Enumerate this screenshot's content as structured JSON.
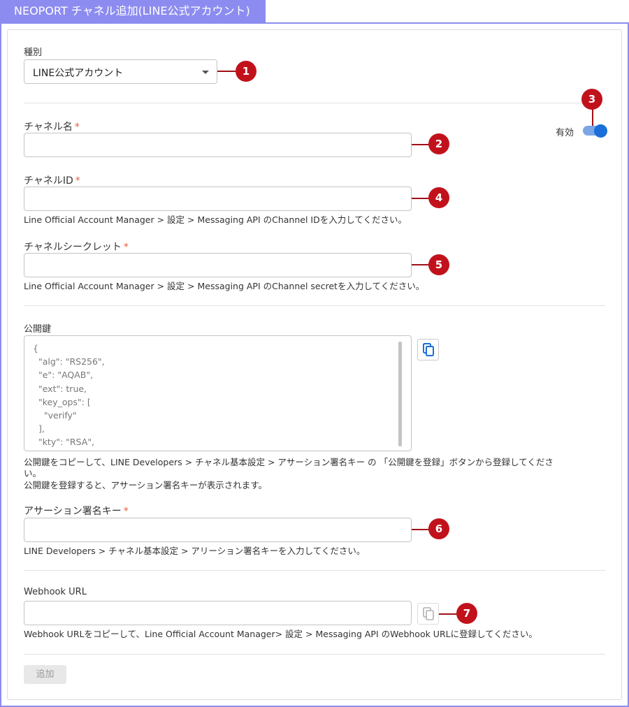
{
  "window": {
    "title": "NEOPORT チャネル追加(LINE公式アカウント)"
  },
  "type_field": {
    "label": "種別",
    "selected": "LINE公式アカウント"
  },
  "enabled_toggle": {
    "label": "有効",
    "on": true
  },
  "channel_name": {
    "label": "チャネル名",
    "required_mark": "*",
    "value": ""
  },
  "channel_id": {
    "label": "チャネルID",
    "required_mark": "*",
    "value": "",
    "hint": "Line Official Account Manager > 設定 > Messaging API のChannel IDを入力してください。"
  },
  "channel_secret": {
    "label": "チャネルシークレット",
    "required_mark": "*",
    "value": "",
    "hint": "Line Official Account Manager > 設定 > Messaging API のChannel secretを入力してください。"
  },
  "public_key": {
    "label": "公開鍵",
    "lines": [
      "{",
      "  \"alg\": \"RS256\",",
      "  \"e\": \"AQAB\",",
      "  \"ext\": true,",
      "  \"key_ops\": [",
      "    \"verify\"",
      "  ],",
      "  \"kty\": \"RSA\","
    ],
    "hint_line1": "公開鍵をコピーして、LINE Developers > チャネル基本設定 > アサーション署名キー の 「公開鍵を登録」ボタンから登録してくださ",
    "hint_line2": "い。",
    "hint_line3": "公開鍵を登録すると、アサーション署名キーが表示されます。"
  },
  "assertion_key": {
    "label": "アサーション署名キー",
    "required_mark": "*",
    "value": "",
    "hint": "LINE Developers > チャネル基本設定 > アリーション署名キーを入力してください。"
  },
  "webhook": {
    "label": "Webhook URL",
    "value": "",
    "hint": "Webhook URLをコピーして、Line Official Account Manager> 設定 > Messaging API のWebhook URLに登録してください。"
  },
  "add_button": {
    "label": "追加",
    "disabled": true
  },
  "markers": [
    "1",
    "2",
    "3",
    "4",
    "5",
    "6",
    "7"
  ],
  "colors": {
    "accent": "#1a6fd8",
    "marker": "#c1121c",
    "title_bar": "#8c8cf0"
  }
}
